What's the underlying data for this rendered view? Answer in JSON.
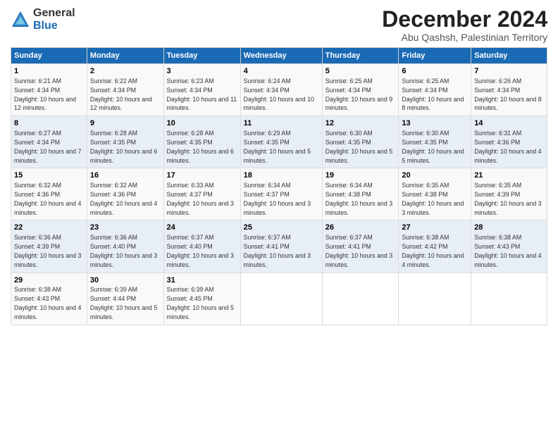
{
  "header": {
    "logo_general": "General",
    "logo_blue": "Blue",
    "main_title": "December 2024",
    "subtitle": "Abu Qashsh, Palestinian Territory"
  },
  "weekdays": [
    "Sunday",
    "Monday",
    "Tuesday",
    "Wednesday",
    "Thursday",
    "Friday",
    "Saturday"
  ],
  "weeks": [
    [
      {
        "day": "1",
        "sunrise": "6:21 AM",
        "sunset": "4:34 PM",
        "daylight": "10 hours and 12 minutes."
      },
      {
        "day": "2",
        "sunrise": "6:22 AM",
        "sunset": "4:34 PM",
        "daylight": "10 hours and 12 minutes."
      },
      {
        "day": "3",
        "sunrise": "6:23 AM",
        "sunset": "4:34 PM",
        "daylight": "10 hours and 11 minutes."
      },
      {
        "day": "4",
        "sunrise": "6:24 AM",
        "sunset": "4:34 PM",
        "daylight": "10 hours and 10 minutes."
      },
      {
        "day": "5",
        "sunrise": "6:25 AM",
        "sunset": "4:34 PM",
        "daylight": "10 hours and 9 minutes."
      },
      {
        "day": "6",
        "sunrise": "6:25 AM",
        "sunset": "4:34 PM",
        "daylight": "10 hours and 8 minutes."
      },
      {
        "day": "7",
        "sunrise": "6:26 AM",
        "sunset": "4:34 PM",
        "daylight": "10 hours and 8 minutes."
      }
    ],
    [
      {
        "day": "8",
        "sunrise": "6:27 AM",
        "sunset": "4:34 PM",
        "daylight": "10 hours and 7 minutes."
      },
      {
        "day": "9",
        "sunrise": "6:28 AM",
        "sunset": "4:35 PM",
        "daylight": "10 hours and 6 minutes."
      },
      {
        "day": "10",
        "sunrise": "6:28 AM",
        "sunset": "4:35 PM",
        "daylight": "10 hours and 6 minutes."
      },
      {
        "day": "11",
        "sunrise": "6:29 AM",
        "sunset": "4:35 PM",
        "daylight": "10 hours and 5 minutes."
      },
      {
        "day": "12",
        "sunrise": "6:30 AM",
        "sunset": "4:35 PM",
        "daylight": "10 hours and 5 minutes."
      },
      {
        "day": "13",
        "sunrise": "6:30 AM",
        "sunset": "4:35 PM",
        "daylight": "10 hours and 5 minutes."
      },
      {
        "day": "14",
        "sunrise": "6:31 AM",
        "sunset": "4:36 PM",
        "daylight": "10 hours and 4 minutes."
      }
    ],
    [
      {
        "day": "15",
        "sunrise": "6:32 AM",
        "sunset": "4:36 PM",
        "daylight": "10 hours and 4 minutes."
      },
      {
        "day": "16",
        "sunrise": "6:32 AM",
        "sunset": "4:36 PM",
        "daylight": "10 hours and 4 minutes."
      },
      {
        "day": "17",
        "sunrise": "6:33 AM",
        "sunset": "4:37 PM",
        "daylight": "10 hours and 3 minutes."
      },
      {
        "day": "18",
        "sunrise": "6:34 AM",
        "sunset": "4:37 PM",
        "daylight": "10 hours and 3 minutes."
      },
      {
        "day": "19",
        "sunrise": "6:34 AM",
        "sunset": "4:38 PM",
        "daylight": "10 hours and 3 minutes."
      },
      {
        "day": "20",
        "sunrise": "6:35 AM",
        "sunset": "4:38 PM",
        "daylight": "10 hours and 3 minutes."
      },
      {
        "day": "21",
        "sunrise": "6:35 AM",
        "sunset": "4:39 PM",
        "daylight": "10 hours and 3 minutes."
      }
    ],
    [
      {
        "day": "22",
        "sunrise": "6:36 AM",
        "sunset": "4:39 PM",
        "daylight": "10 hours and 3 minutes."
      },
      {
        "day": "23",
        "sunrise": "6:36 AM",
        "sunset": "4:40 PM",
        "daylight": "10 hours and 3 minutes."
      },
      {
        "day": "24",
        "sunrise": "6:37 AM",
        "sunset": "4:40 PM",
        "daylight": "10 hours and 3 minutes."
      },
      {
        "day": "25",
        "sunrise": "6:37 AM",
        "sunset": "4:41 PM",
        "daylight": "10 hours and 3 minutes."
      },
      {
        "day": "26",
        "sunrise": "6:37 AM",
        "sunset": "4:41 PM",
        "daylight": "10 hours and 3 minutes."
      },
      {
        "day": "27",
        "sunrise": "6:38 AM",
        "sunset": "4:42 PM",
        "daylight": "10 hours and 4 minutes."
      },
      {
        "day": "28",
        "sunrise": "6:38 AM",
        "sunset": "4:43 PM",
        "daylight": "10 hours and 4 minutes."
      }
    ],
    [
      {
        "day": "29",
        "sunrise": "6:38 AM",
        "sunset": "4:43 PM",
        "daylight": "10 hours and 4 minutes."
      },
      {
        "day": "30",
        "sunrise": "6:39 AM",
        "sunset": "4:44 PM",
        "daylight": "10 hours and 5 minutes."
      },
      {
        "day": "31",
        "sunrise": "6:39 AM",
        "sunset": "4:45 PM",
        "daylight": "10 hours and 5 minutes."
      },
      null,
      null,
      null,
      null
    ]
  ],
  "labels": {
    "sunrise": "Sunrise:",
    "sunset": "Sunset:",
    "daylight": "Daylight:"
  }
}
